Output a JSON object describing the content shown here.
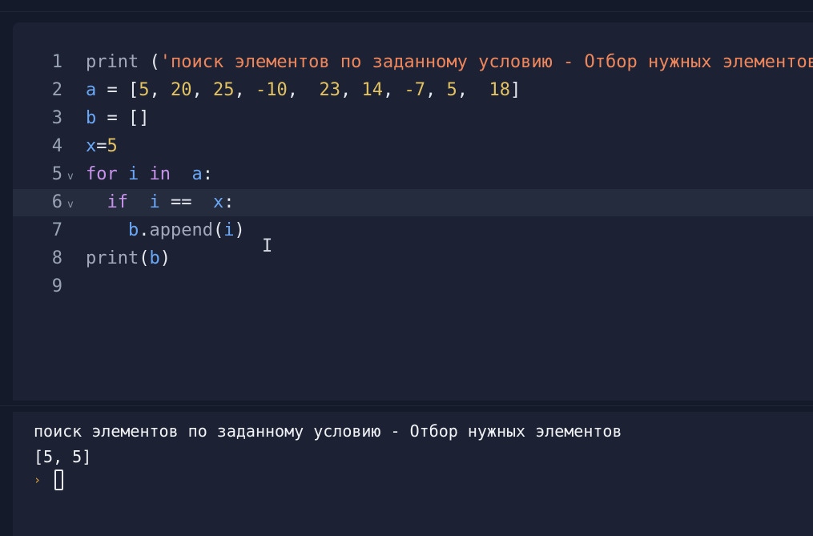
{
  "editor": {
    "lines": [
      {
        "number": "1",
        "fold": "",
        "tokens": [
          {
            "t": "print",
            "c": "fn"
          },
          {
            "t": " (",
            "c": "op"
          },
          {
            "t": "'поиск элементов по заданному условию - Отбор нужных элементов",
            "c": "str"
          }
        ]
      },
      {
        "number": "2",
        "fold": "",
        "tokens": [
          {
            "t": "a",
            "c": "id"
          },
          {
            "t": " = [",
            "c": "op"
          },
          {
            "t": "5",
            "c": "num"
          },
          {
            "t": ", ",
            "c": "op"
          },
          {
            "t": "20",
            "c": "num"
          },
          {
            "t": ", ",
            "c": "op"
          },
          {
            "t": "25",
            "c": "num"
          },
          {
            "t": ", ",
            "c": "op"
          },
          {
            "t": "-10",
            "c": "num"
          },
          {
            "t": ",  ",
            "c": "op"
          },
          {
            "t": "23",
            "c": "num"
          },
          {
            "t": ", ",
            "c": "op"
          },
          {
            "t": "14",
            "c": "num"
          },
          {
            "t": ", ",
            "c": "op"
          },
          {
            "t": "-7",
            "c": "num"
          },
          {
            "t": ", ",
            "c": "op"
          },
          {
            "t": "5",
            "c": "num"
          },
          {
            "t": ",  ",
            "c": "op"
          },
          {
            "t": "18",
            "c": "num"
          },
          {
            "t": "]",
            "c": "op"
          }
        ]
      },
      {
        "number": "3",
        "fold": "",
        "tokens": [
          {
            "t": "b",
            "c": "id"
          },
          {
            "t": " = []",
            "c": "op"
          }
        ]
      },
      {
        "number": "4",
        "fold": "",
        "tokens": [
          {
            "t": "x",
            "c": "id"
          },
          {
            "t": "=",
            "c": "op"
          },
          {
            "t": "5",
            "c": "num"
          }
        ]
      },
      {
        "number": "5",
        "fold": "v",
        "tokens": [
          {
            "t": "for",
            "c": "kw"
          },
          {
            "t": " ",
            "c": "op"
          },
          {
            "t": "i",
            "c": "id"
          },
          {
            "t": " ",
            "c": "op"
          },
          {
            "t": "in",
            "c": "kw"
          },
          {
            "t": "  ",
            "c": "op"
          },
          {
            "t": "a",
            "c": "id"
          },
          {
            "t": ":",
            "c": "op"
          }
        ]
      },
      {
        "number": "6",
        "fold": "v",
        "active": true,
        "tokens": [
          {
            "t": "  ",
            "c": "op"
          },
          {
            "t": "if",
            "c": "kw"
          },
          {
            "t": "  ",
            "c": "op"
          },
          {
            "t": "i",
            "c": "id"
          },
          {
            "t": " ==  ",
            "c": "op"
          },
          {
            "t": "x",
            "c": "id"
          },
          {
            "t": ":",
            "c": "op"
          }
        ]
      },
      {
        "number": "7",
        "fold": "",
        "tokens": [
          {
            "t": "    ",
            "c": "op"
          },
          {
            "t": "b",
            "c": "id"
          },
          {
            "t": ".",
            "c": "op"
          },
          {
            "t": "append",
            "c": "fn"
          },
          {
            "t": "(",
            "c": "op"
          },
          {
            "t": "i",
            "c": "id"
          },
          {
            "t": ")",
            "c": "op"
          }
        ]
      },
      {
        "number": "8",
        "fold": "",
        "tokens": [
          {
            "t": "print",
            "c": "fn"
          },
          {
            "t": "(",
            "c": "op"
          },
          {
            "t": "b",
            "c": "id"
          },
          {
            "t": ")",
            "c": "op"
          }
        ]
      },
      {
        "number": "9",
        "fold": "",
        "tokens": []
      }
    ],
    "cursor_glyph": "I"
  },
  "console": {
    "output_lines": [
      "поиск элементов по заданному условию - Отбор нужных элементов",
      "[5, 5]"
    ],
    "prompt_symbol": "›"
  },
  "colors": {
    "keyword": "#c792ea",
    "identifier": "#6aa7f6",
    "number": "#e3c262",
    "string": "#f0875c",
    "function": "#a3a9ba",
    "prompt": "#e3a43b"
  }
}
